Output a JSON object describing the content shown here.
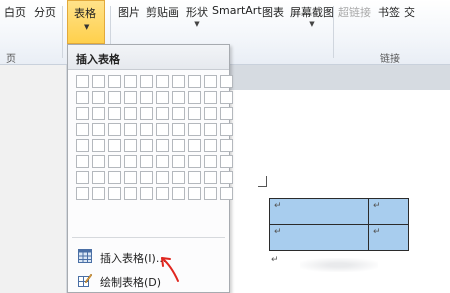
{
  "ribbon": {
    "left_buttons": [
      "白页",
      "分页"
    ],
    "table_button": "表格",
    "insert_buttons": [
      "图片",
      "剪贴画",
      "形状",
      "SmartArt",
      "图表",
      "屏幕截图"
    ],
    "link_buttons": [
      "超链接",
      "书签",
      "交"
    ],
    "group_labels": {
      "pages": "页",
      "links": "链接"
    }
  },
  "dropdown": {
    "header": "插入表格",
    "grid_rows": 8,
    "grid_cols": 10,
    "items": [
      {
        "label": "插入表格(I)...",
        "icon": "insert-table-icon"
      },
      {
        "label": "绘制表格(D)",
        "icon": "draw-table-icon"
      }
    ]
  },
  "document": {
    "cell_mark": "↵",
    "table": [
      [
        "↵",
        "↵"
      ],
      [
        "↵",
        "↵"
      ]
    ]
  },
  "colors": {
    "active_button": "#ffd04c",
    "table_cell_fill": "#a8cdee",
    "annotation": "#e0261f"
  }
}
